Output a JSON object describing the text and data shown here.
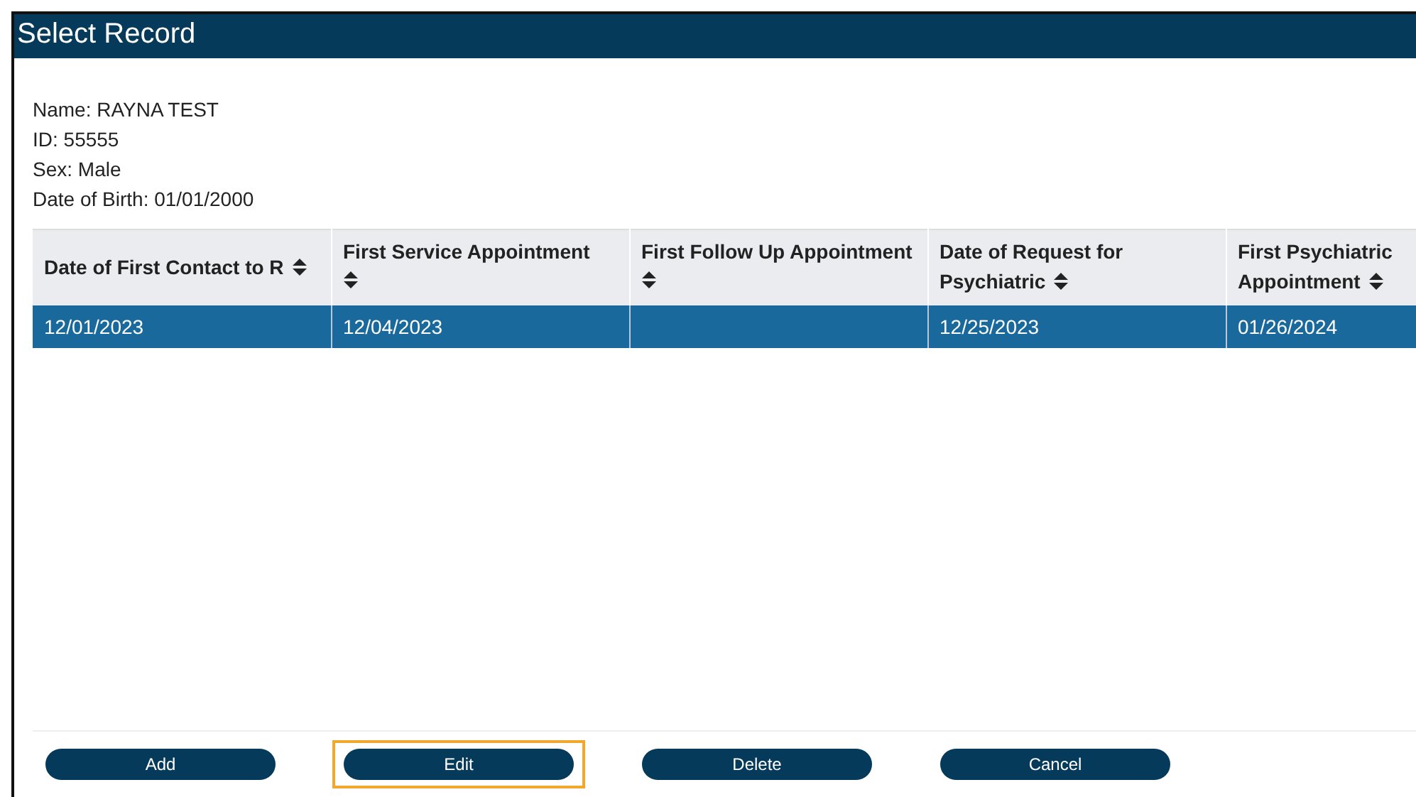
{
  "window": {
    "title": "Select Record"
  },
  "patient": [
    "Name: RAYNA TEST",
    "ID: 55555",
    "Sex: Male",
    "Date of Birth: 01/01/2000"
  ],
  "table": {
    "columns": [
      {
        "label": "Date of First Contact to R"
      },
      {
        "label": "First Service Appointment"
      },
      {
        "label": "First Follow Up Appointment"
      },
      {
        "label": "Date of Request for Psychiatric"
      },
      {
        "label": "First Psychiatric Appointment"
      }
    ],
    "rows": [
      {
        "selected": true,
        "cells": [
          "12/01/2023",
          "12/04/2023",
          "",
          "12/25/2023",
          "01/26/2024"
        ]
      }
    ]
  },
  "buttons": [
    {
      "label": "Add",
      "focused": false
    },
    {
      "label": "Edit",
      "focused": true
    },
    {
      "label": "Delete",
      "focused": false
    },
    {
      "label": "Cancel",
      "focused": false
    }
  ]
}
